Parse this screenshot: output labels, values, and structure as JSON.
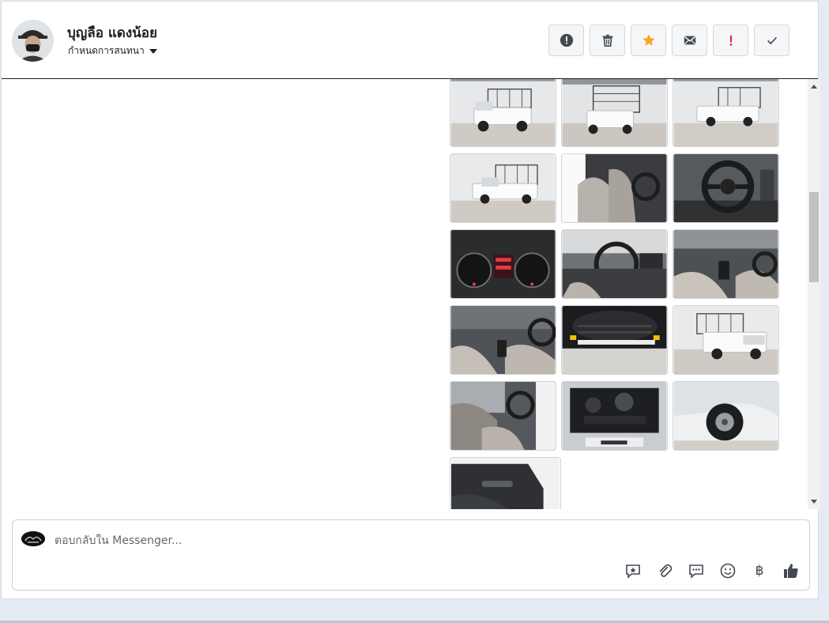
{
  "header": {
    "contact_name": "บุญลือ แดงน้อย",
    "assign_label": "กำหนดการสนทนา"
  },
  "actions": [
    {
      "name": "report-spam-button",
      "icon": "alert-circle-icon",
      "color": "#444950"
    },
    {
      "name": "delete-button",
      "icon": "trash-icon",
      "color": "#444950"
    },
    {
      "name": "star-button",
      "icon": "star-icon",
      "color": "#f5a623"
    },
    {
      "name": "mark-unread-button",
      "icon": "envelope-icon",
      "color": "#444950"
    },
    {
      "name": "mark-important-button",
      "icon": "exclamation-icon",
      "color": "#e41e3f"
    },
    {
      "name": "mark-done-button",
      "icon": "check-icon",
      "color": "#444950"
    }
  ],
  "photos": [
    {
      "subject": "truck-front-left"
    },
    {
      "subject": "truck-rear"
    },
    {
      "subject": "truck-rear-right"
    },
    {
      "subject": "truck-side"
    },
    {
      "subject": "cabin-seats"
    },
    {
      "subject": "steering-wheel"
    },
    {
      "subject": "gauge-cluster"
    },
    {
      "subject": "dashboard"
    },
    {
      "subject": "gear-shifter"
    },
    {
      "subject": "center-console"
    },
    {
      "subject": "undercarriage"
    },
    {
      "subject": "truck-front"
    },
    {
      "subject": "interior-seats"
    },
    {
      "subject": "engine-bay"
    },
    {
      "subject": "wheel-arch"
    },
    {
      "subject": "door-panel"
    }
  ],
  "composer": {
    "placeholder": "ตอบกลับใน Messenger...",
    "tools": [
      "saved-reply-icon",
      "attachment-icon",
      "chat-icon",
      "emoji-icon",
      "baht-icon",
      "thumbs-up-icon"
    ],
    "baht_symbol": "฿"
  }
}
